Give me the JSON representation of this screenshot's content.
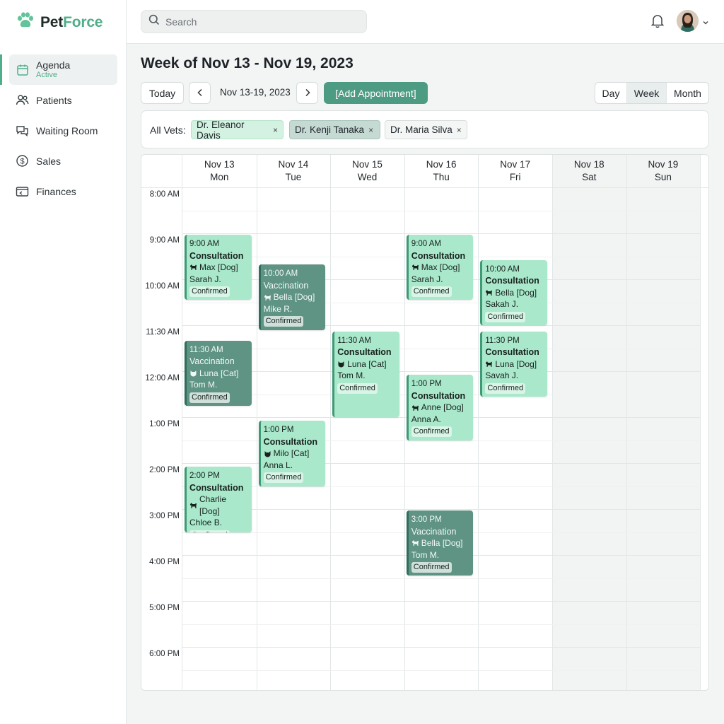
{
  "brand": {
    "part1": "Pet",
    "part2": "Force",
    "accent": "#4fae8a"
  },
  "sidebar": {
    "items": [
      {
        "label": "Agenda",
        "sub": "Active",
        "icon": "calendar-icon"
      },
      {
        "label": "Patients",
        "icon": "users-icon"
      },
      {
        "label": "Waiting Room",
        "icon": "chat-icon"
      },
      {
        "label": "Sales",
        "icon": "dollar-icon"
      },
      {
        "label": "Finances",
        "icon": "wallet-icon"
      }
    ]
  },
  "topbar": {
    "search_placeholder": "Search"
  },
  "header": {
    "title": "Week of Nov 13 - Nov 19, 2023",
    "today_label": "Today",
    "range_label": "Nov 13-19, 2023",
    "add_label": "[Add Appointment]",
    "views": {
      "day": "Day",
      "week": "Week",
      "month": "Month",
      "active": "Week"
    }
  },
  "filters": {
    "label": "All Vets:",
    "chips": [
      "Dr. Eleanor Davis",
      "Dr. Kenji Tanaka",
      "Dr. Maria Silva"
    ],
    "remove_glyph": "×"
  },
  "calendar": {
    "days": [
      {
        "date": "Nov 13",
        "dow": "Mon"
      },
      {
        "date": "Nov 14",
        "dow": "Tue"
      },
      {
        "date": "Nov 15",
        "dow": "Wed"
      },
      {
        "date": "Nov 16",
        "dow": "Thu"
      },
      {
        "date": "Nov 17",
        "dow": "Fri"
      },
      {
        "date": "Nov 18",
        "dow": "Sat"
      },
      {
        "date": "Nov 19",
        "dow": "Sun"
      }
    ],
    "times": [
      "8:00 AM",
      "9:00 AM",
      "10:00 AM",
      "11:30 AM",
      "12:00 AM",
      "1:00 PM",
      "2:00 PM",
      "3:00 PM",
      "4:00 PM",
      "5:00 PM",
      "6:00 PM"
    ],
    "appointments": [
      {
        "day": 0,
        "slot": 1.0,
        "length": 1.45,
        "time": "9:00 AM",
        "type": "Consultation",
        "pet": "Max [Dog]",
        "species": "dog",
        "owner": "Sarah J.",
        "status": "Confirmed",
        "style": "light"
      },
      {
        "day": 0,
        "slot": 3.3,
        "length": 1.45,
        "time": "11:30 AM",
        "type": "Vaccination",
        "pet": "Luna [Cat]",
        "species": "cat",
        "owner": "Tom M.",
        "status": "Confirmed",
        "style": "dark"
      },
      {
        "day": 0,
        "slot": 6.05,
        "length": 1.45,
        "time": "2:00 PM",
        "type": "Consultation",
        "pet": "Charlie [Dog]",
        "species": "dog",
        "owner": "Chloe B.",
        "status": "Confirmed",
        "style": "light"
      },
      {
        "day": 1,
        "slot": 1.65,
        "length": 1.45,
        "time": "10:00 AM",
        "type": "Vaccination",
        "pet": "Bella [Dog]",
        "species": "dog",
        "owner": "Mike R.",
        "status": "Confirmed",
        "style": "dark"
      },
      {
        "day": 1,
        "slot": 5.05,
        "length": 1.45,
        "time": "1:00 PM",
        "type": "Consultation",
        "pet": "Milo [Cat]",
        "species": "cat",
        "owner": "Anna L.",
        "status": "Confirmed",
        "style": "light"
      },
      {
        "day": 2,
        "slot": 3.1,
        "length": 1.9,
        "time": "11:30 AM",
        "type": "Consultation",
        "pet": "Luna [Cat]",
        "species": "cat",
        "owner": "Tom M.",
        "status": "Confirmed",
        "style": "light"
      },
      {
        "day": 3,
        "slot": 1.0,
        "length": 1.45,
        "time": "9:00 AM",
        "type": "Consultation",
        "pet": "Max [Dog]",
        "species": "dog",
        "owner": "Sarah J.",
        "status": "Confirmed",
        "style": "light"
      },
      {
        "day": 3,
        "slot": 4.05,
        "length": 1.45,
        "time": "1:00 PM",
        "type": "Consultation",
        "pet": "Anne [Dog]",
        "species": "dog",
        "owner": "Anna A.",
        "status": "Confirmed",
        "style": "light"
      },
      {
        "day": 3,
        "slot": 7.0,
        "length": 1.45,
        "time": "3:00 PM",
        "type": "Vaccination",
        "pet": "Bella [Dog]",
        "species": "dog",
        "owner": "Tom M.",
        "status": "Confirmed",
        "style": "dark"
      },
      {
        "day": 4,
        "slot": 1.55,
        "length": 1.45,
        "time": "10:00 AM",
        "type": "Consultation",
        "pet": "Bella [Dog]",
        "species": "dog",
        "owner": "Sakah J.",
        "status": "Confirmed",
        "style": "light"
      },
      {
        "day": 4,
        "slot": 3.1,
        "length": 1.45,
        "time": "11:30 PM",
        "type": "Consultation",
        "pet": "Luna [Dog]",
        "species": "dog",
        "owner": "Savah J.",
        "status": "Confirmed",
        "style": "light"
      }
    ]
  }
}
